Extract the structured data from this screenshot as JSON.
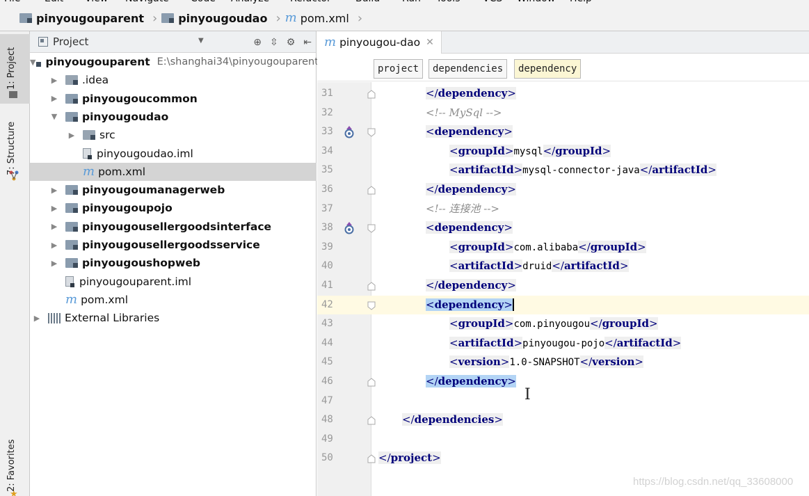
{
  "menu": [
    "File",
    "Edit",
    "View",
    "Navigate",
    "Code",
    "Analyze",
    "Refactor",
    "Build",
    "Run",
    "Tools",
    "VCS",
    "Window",
    "Help"
  ],
  "breadcrumb": [
    {
      "label": "pinyougouparent",
      "icon": "module-folder-icon"
    },
    {
      "label": "pinyougoudao",
      "icon": "module-folder-icon"
    },
    {
      "label": "pom.xml",
      "icon": "maven-file-icon"
    }
  ],
  "left_strip": {
    "project_tab": "1: Project",
    "structure_tab": "7: Structure",
    "favorites_tab": "2: Favorites"
  },
  "project_panel": {
    "title": "Project",
    "tree": [
      {
        "label": "pinyougouparent",
        "hint": "E:\\shanghai34\\pinyougouparent",
        "bold": true,
        "arrow": "▼",
        "indent": 0,
        "icon": "module-folder-icon"
      },
      {
        "label": ".idea",
        "bold": false,
        "arrow": "▶",
        "indent": 1,
        "icon": "folder-icon"
      },
      {
        "label": "pinyougoucommon",
        "bold": true,
        "arrow": "▶",
        "indent": 1,
        "icon": "module-folder-icon"
      },
      {
        "label": "pinyougoudao",
        "bold": true,
        "arrow": "▼",
        "indent": 1,
        "icon": "module-folder-icon"
      },
      {
        "label": "src",
        "bold": false,
        "arrow": "▶",
        "indent": 2,
        "icon": "folder-icon"
      },
      {
        "label": "pinyougoudao.iml",
        "bold": false,
        "arrow": "",
        "indent": 2,
        "icon": "iml-file-icon"
      },
      {
        "label": "pom.xml",
        "bold": false,
        "arrow": "",
        "indent": 2,
        "icon": "maven-file-icon",
        "selected": true
      },
      {
        "label": "pinyougoumanagerweb",
        "bold": true,
        "arrow": "▶",
        "indent": 1,
        "icon": "module-folder-icon"
      },
      {
        "label": "pinyougoupojo",
        "bold": true,
        "arrow": "▶",
        "indent": 1,
        "icon": "module-folder-icon"
      },
      {
        "label": "pinyougousellergoodsinterface",
        "bold": true,
        "arrow": "▶",
        "indent": 1,
        "icon": "module-folder-icon"
      },
      {
        "label": "pinyougousellergoodsservice",
        "bold": true,
        "arrow": "▶",
        "indent": 1,
        "icon": "module-folder-icon"
      },
      {
        "label": "pinyougoushopweb",
        "bold": true,
        "arrow": "▶",
        "indent": 1,
        "icon": "module-folder-icon"
      },
      {
        "label": "pinyougouparent.iml",
        "bold": false,
        "arrow": "",
        "indent": 1,
        "icon": "iml-file-icon"
      },
      {
        "label": "pom.xml",
        "bold": false,
        "arrow": "",
        "indent": 1,
        "icon": "maven-file-icon"
      },
      {
        "label": "External Libraries",
        "bold": false,
        "arrow": "▶",
        "indent": 0,
        "icon": "libraries-icon"
      }
    ]
  },
  "editor": {
    "tab_label": "pinyougou-dao",
    "xml_path": [
      "project",
      "dependencies",
      "dependency"
    ],
    "lines": [
      {
        "no": "31",
        "indent": 2,
        "parts": [
          [
            "close",
            "dependency"
          ]
        ]
      },
      {
        "no": "32",
        "indent": 2,
        "parts": [
          [
            "comment",
            "<!-- MySql -->"
          ]
        ]
      },
      {
        "no": "33",
        "indent": 2,
        "parts": [
          [
            "open",
            "dependency"
          ]
        ],
        "mark": true
      },
      {
        "no": "34",
        "indent": 3,
        "parts": [
          [
            "open",
            "groupId"
          ],
          [
            "val",
            "mysql"
          ],
          [
            "close",
            "groupId"
          ]
        ]
      },
      {
        "no": "35",
        "indent": 3,
        "parts": [
          [
            "open",
            "artifactId"
          ],
          [
            "val",
            "mysql-connector-java"
          ],
          [
            "close",
            "artifactId"
          ]
        ]
      },
      {
        "no": "36",
        "indent": 2,
        "parts": [
          [
            "close",
            "dependency"
          ]
        ]
      },
      {
        "no": "37",
        "indent": 2,
        "parts": [
          [
            "comment",
            "<!-- 连接池 -->"
          ]
        ]
      },
      {
        "no": "38",
        "indent": 2,
        "parts": [
          [
            "open",
            "dependency"
          ]
        ],
        "mark": true
      },
      {
        "no": "39",
        "indent": 3,
        "parts": [
          [
            "open",
            "groupId"
          ],
          [
            "val",
            "com.alibaba"
          ],
          [
            "close",
            "groupId"
          ]
        ]
      },
      {
        "no": "40",
        "indent": 3,
        "parts": [
          [
            "open",
            "artifactId"
          ],
          [
            "val",
            "druid"
          ],
          [
            "close",
            "artifactId"
          ]
        ]
      },
      {
        "no": "41",
        "indent": 2,
        "parts": [
          [
            "close",
            "dependency"
          ]
        ]
      },
      {
        "no": "42",
        "indent": 2,
        "parts": [
          [
            "open",
            "dependency"
          ]
        ],
        "current": true,
        "highlight": true
      },
      {
        "no": "43",
        "indent": 3,
        "parts": [
          [
            "open",
            "groupId"
          ],
          [
            "val",
            "com.pinyougou"
          ],
          [
            "close",
            "groupId"
          ]
        ]
      },
      {
        "no": "44",
        "indent": 3,
        "parts": [
          [
            "open",
            "artifactId"
          ],
          [
            "val",
            "pinyougou-pojo"
          ],
          [
            "close",
            "artifactId"
          ]
        ]
      },
      {
        "no": "45",
        "indent": 3,
        "parts": [
          [
            "open",
            "version"
          ],
          [
            "val",
            "1.0-SNAPSHOT"
          ],
          [
            "close",
            "version"
          ]
        ]
      },
      {
        "no": "46",
        "indent": 2,
        "parts": [
          [
            "close",
            "dependency"
          ]
        ],
        "highlight": true
      },
      {
        "no": "47",
        "indent": 0,
        "parts": []
      },
      {
        "no": "48",
        "indent": 1,
        "parts": [
          [
            "close",
            "dependencies"
          ]
        ]
      },
      {
        "no": "49",
        "indent": 0,
        "parts": []
      },
      {
        "no": "50",
        "indent": 0,
        "parts": [
          [
            "close",
            "project"
          ]
        ]
      }
    ]
  },
  "watermark": "https://blog.csdn.net/qq_33608000",
  "colors": {
    "tag": "#00007a",
    "comment": "#8c8c8c",
    "tag_match": "#b3d4f5",
    "caret_row": "#fffae3",
    "selection": "#d4d4d4"
  }
}
